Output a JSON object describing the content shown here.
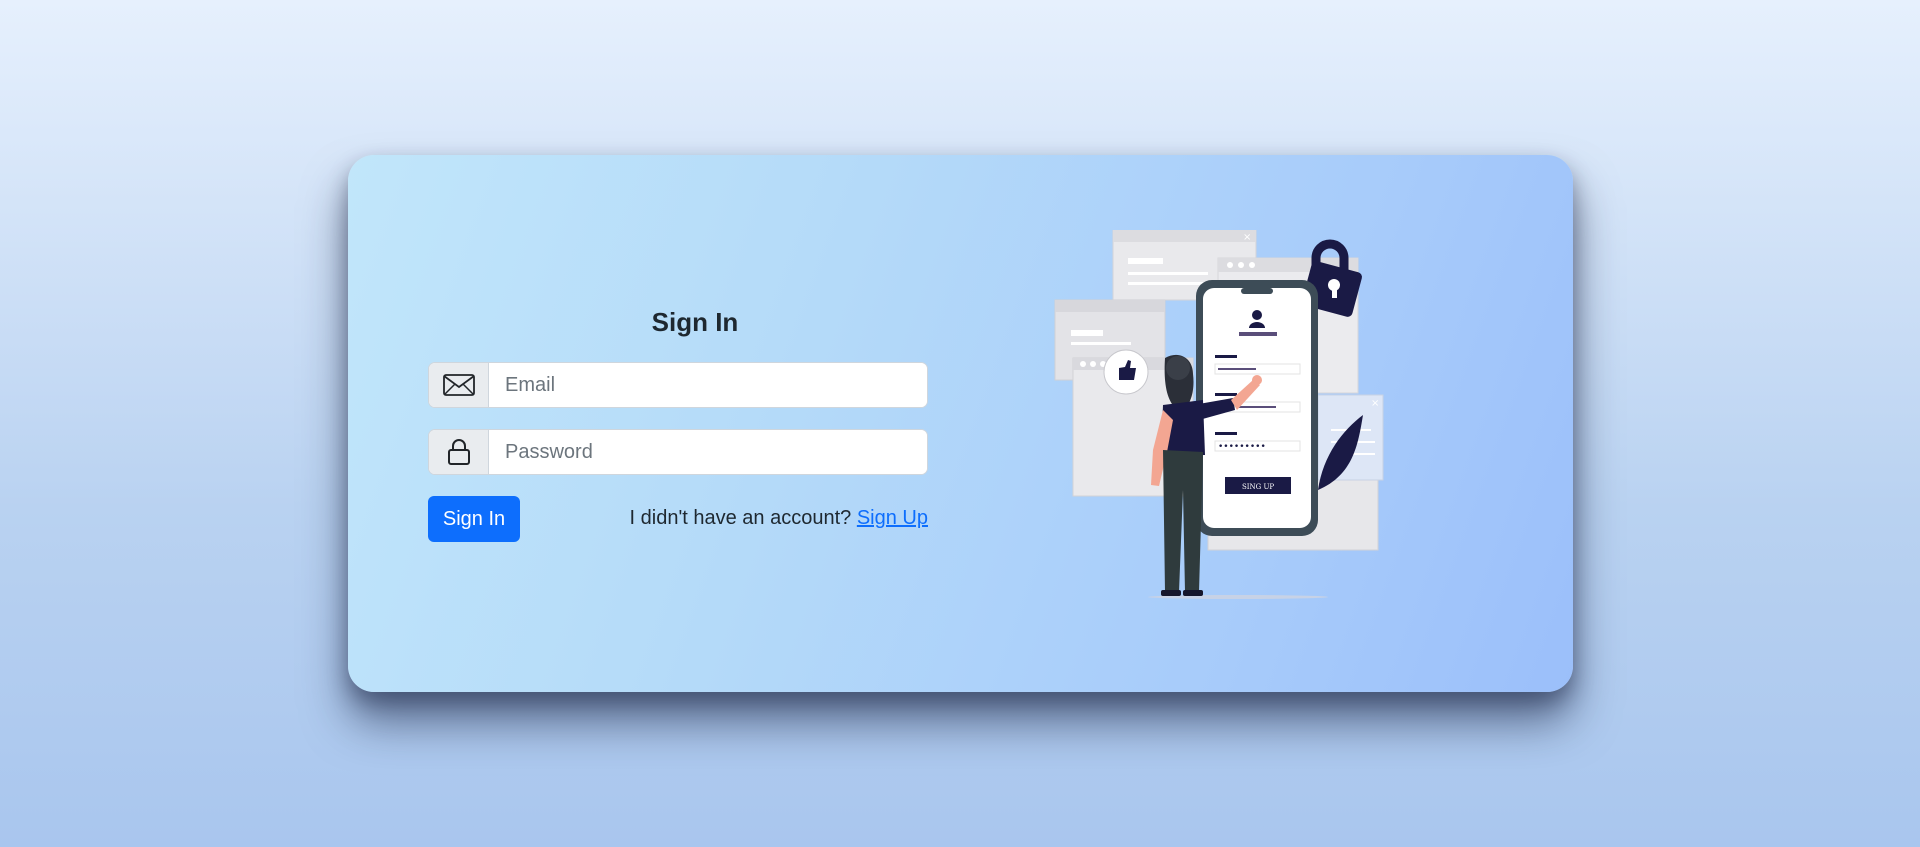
{
  "signin": {
    "title": "Sign In",
    "email": {
      "placeholder": "Email",
      "value": "",
      "icon": "envelope-icon"
    },
    "password": {
      "placeholder": "Password",
      "value": "",
      "icon": "lock-icon"
    },
    "submit_label": "Sign In",
    "account_prompt": "I didn't have an account?",
    "signup_link": "Sign Up"
  },
  "illustration": {
    "phone_button": "SING UP",
    "password_mask": "•••••••••"
  },
  "colors": {
    "primary": "#0d6efd",
    "navy": "#1a1a45",
    "text": "#1e2830"
  }
}
